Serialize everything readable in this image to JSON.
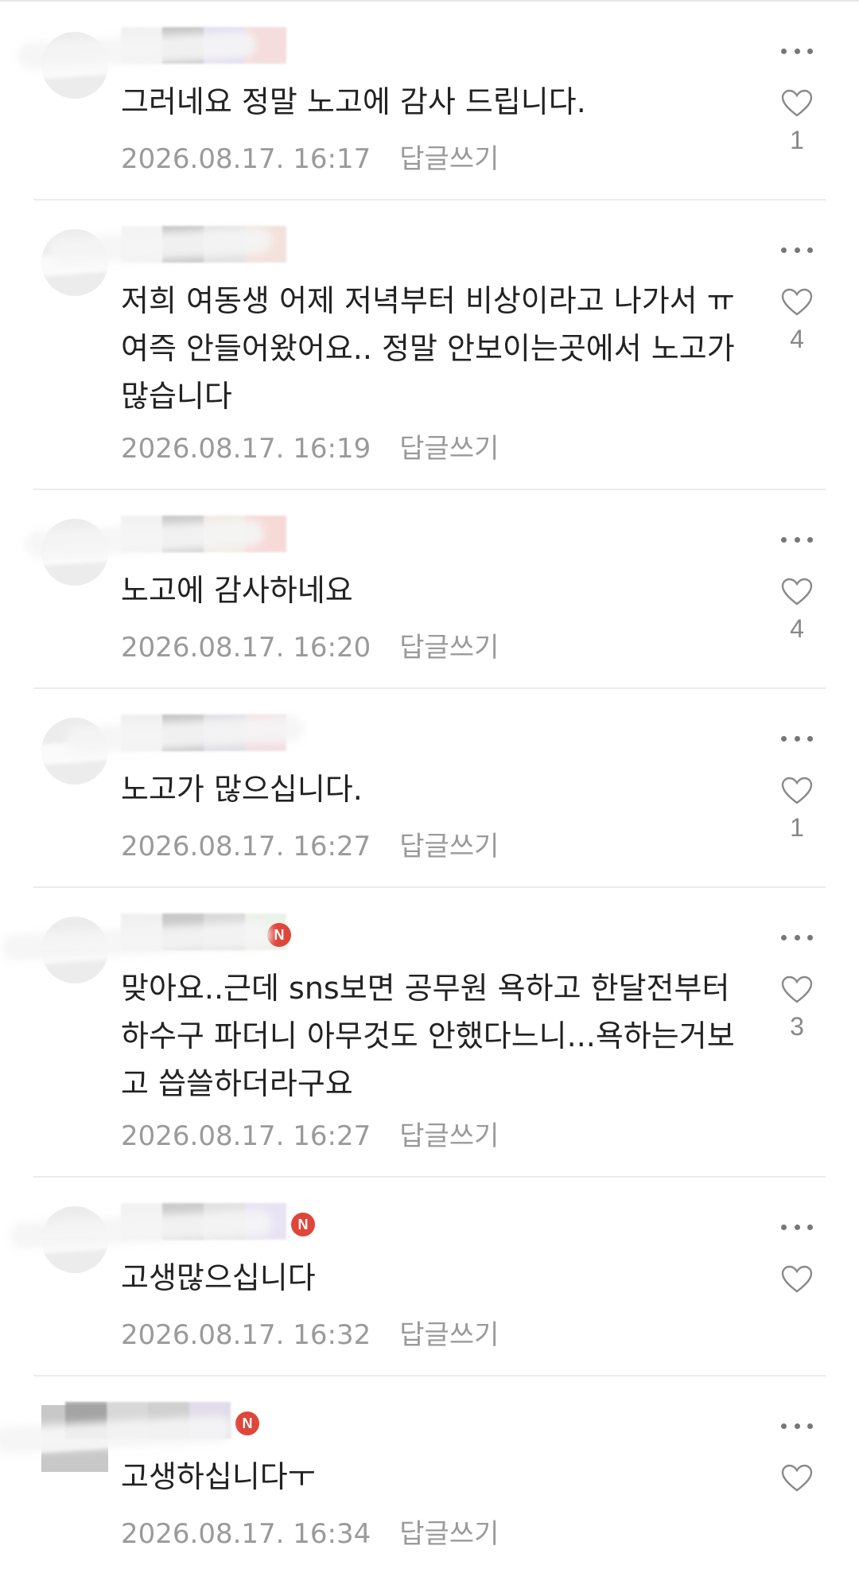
{
  "reply_label": "답글쓰기",
  "comments": [
    {
      "text": "그러네요 정말 노고에 감사 드립니다.",
      "date": "2026.08.17. 16:17",
      "likes": "1"
    },
    {
      "text": "저희 여동생 어제 저녁부터 비상이라고 나가서 ㅠ\n여즉 안들어왔어요.. 정말 안보이는곳에서 노고가\n많습니다",
      "date": "2026.08.17. 16:19",
      "likes": "4"
    },
    {
      "text": "노고에 감사하네요",
      "date": "2026.08.17. 16:20",
      "likes": "4"
    },
    {
      "text": "노고가 많으십니다.",
      "date": "2026.08.17. 16:27",
      "likes": "1"
    },
    {
      "text": "맞아요..근데 sns보면 공무원 욕하고 한달전부터\n하수구 파더니 아무것도 안했다느니...욕하는거보\n고 씁쓸하더라구요",
      "date": "2026.08.17. 16:27",
      "likes": "3",
      "badge": "N"
    },
    {
      "text": "고생많으십니다",
      "date": "2026.08.17. 16:32",
      "likes": "",
      "badge": "N"
    },
    {
      "text": "고생하십니다ㅜ",
      "date": "2026.08.17. 16:34",
      "likes": "",
      "badge": "N"
    }
  ]
}
